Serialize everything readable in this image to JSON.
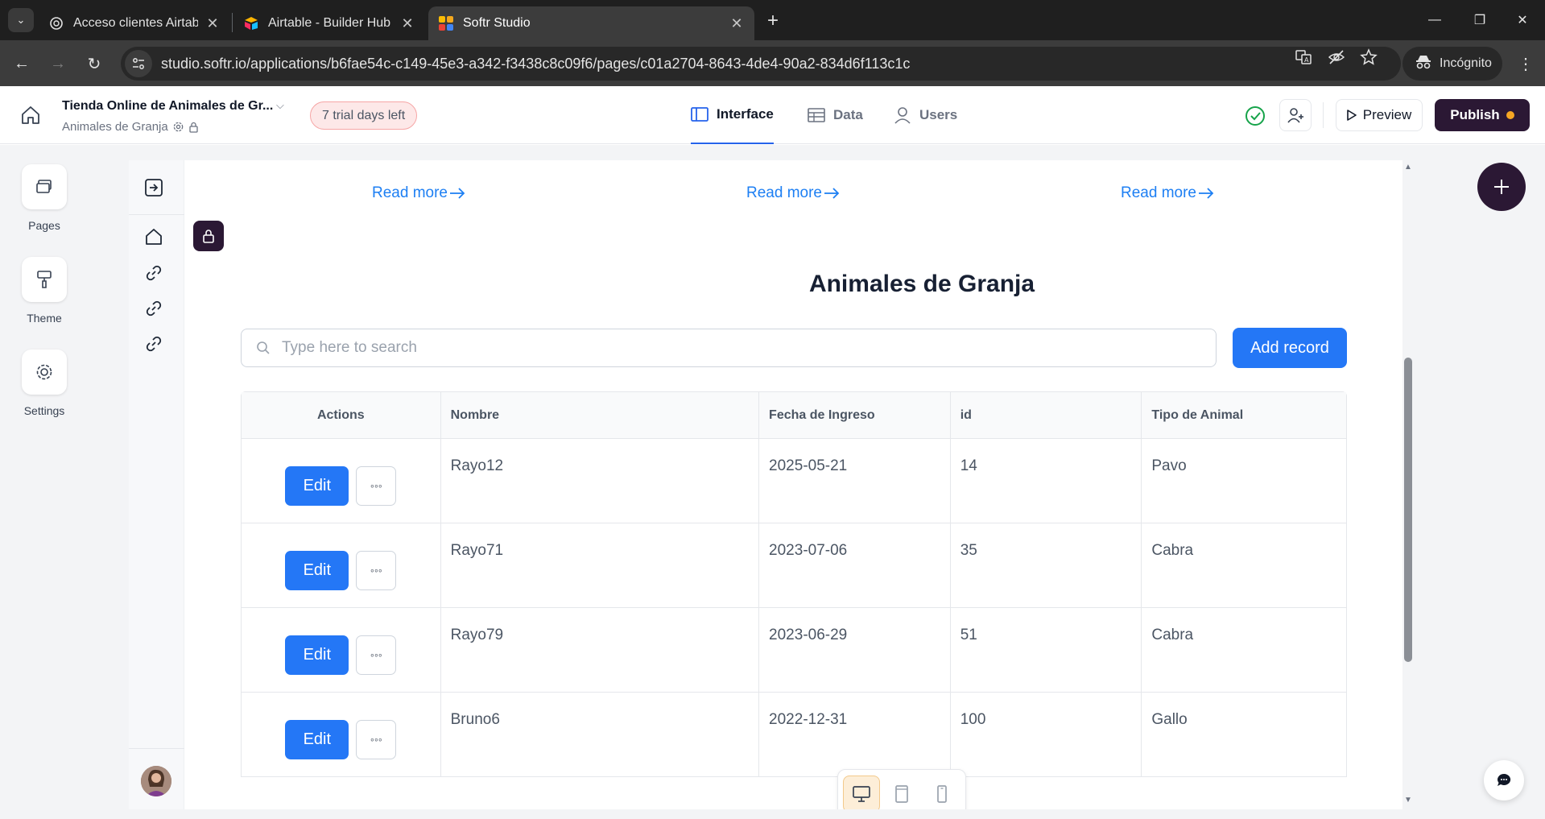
{
  "browser": {
    "tabs": [
      {
        "title": "Acceso clientes Airtable pedido",
        "active": false
      },
      {
        "title": "Airtable - Builder Hub",
        "active": false
      },
      {
        "title": "Softr Studio",
        "active": true
      }
    ],
    "url": "studio.softr.io/applications/b6fae54c-c149-45e3-a342-f3438c8c09f6/pages/c01a2704-8643-4de4-90a2-834d6f113c1c",
    "profile_label": "Incógnito"
  },
  "header": {
    "app_name": "Tienda Online de Animales de Gr...",
    "app_subtitle": "Animales de Granja",
    "trial_badge": "7 trial days left",
    "tabs": [
      {
        "label": "Interface",
        "icon": "layout-icon",
        "active": true
      },
      {
        "label": "Data",
        "icon": "table-icon",
        "active": false
      },
      {
        "label": "Users",
        "icon": "user-icon",
        "active": false
      }
    ],
    "preview_label": "Preview",
    "publish_label": "Publish"
  },
  "left_nav": [
    {
      "label": "Pages",
      "icon": "pages-icon"
    },
    {
      "label": "Theme",
      "icon": "paint-roller-icon"
    },
    {
      "label": "Settings",
      "icon": "gear-icon"
    }
  ],
  "canvas": {
    "read_more_links": [
      "Read more",
      "Read more",
      "Read more"
    ],
    "title": "Animales de Granja",
    "search_placeholder": "Type here to search",
    "add_record_label": "Add record",
    "table": {
      "columns": [
        "Actions",
        "Nombre",
        "Fecha de Ingreso",
        "id",
        "Tipo de Animal"
      ],
      "edit_label": "Edit",
      "rows": [
        {
          "nombre": "Rayo12",
          "fecha": "2025-05-21",
          "id": "14",
          "tipo": "Pavo"
        },
        {
          "nombre": "Rayo71",
          "fecha": "2023-07-06",
          "id": "35",
          "tipo": "Cabra"
        },
        {
          "nombre": "Rayo79",
          "fecha": "2023-06-29",
          "id": "51",
          "tipo": "Cabra"
        },
        {
          "nombre": "Bruno6",
          "fecha": "2022-12-31",
          "id": "100",
          "tipo": "Gallo"
        }
      ]
    },
    "device_modes": [
      {
        "name": "desktop",
        "active": true
      },
      {
        "name": "tablet",
        "active": false
      },
      {
        "name": "mobile",
        "active": false
      }
    ]
  },
  "colors": {
    "primary_blue": "#2477f6",
    "link_blue": "#1d7ff3",
    "brand_dark": "#2b1834",
    "publish_dot": "#f5a623",
    "trial_bg": "#fde8e8"
  }
}
